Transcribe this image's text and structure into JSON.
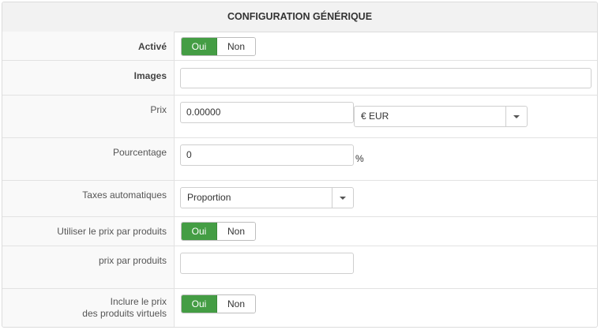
{
  "header": {
    "title": "CONFIGURATION GÉNÉRIQUE"
  },
  "rows": {
    "active": {
      "label": "Activé",
      "yes": "Oui",
      "no": "Non",
      "selected": "Oui"
    },
    "images": {
      "label": "Images",
      "value": ""
    },
    "price": {
      "label": "Prix",
      "value": "0.00000",
      "currency": "€ EUR"
    },
    "percentage": {
      "label": "Pourcentage",
      "value": "0",
      "suffix": "%"
    },
    "auto_taxes": {
      "label": "Taxes automatiques",
      "value": "Proportion"
    },
    "use_product_price": {
      "label": "Utiliser le prix par produits",
      "yes": "Oui",
      "no": "Non",
      "selected": "Oui"
    },
    "price_per_product": {
      "label": "prix par produits",
      "value": ""
    },
    "include_virtual": {
      "label_line1": "Inclure le prix",
      "label_line2": "des produits virtuels",
      "yes": "Oui",
      "no": "Non",
      "selected": "Oui"
    }
  },
  "colors": {
    "toggle_active": "#449d44",
    "header_bg": "#f2f2f2",
    "label_bg": "#f9f9f9"
  },
  "icons": {
    "dropdown": "chevron-down-icon"
  }
}
